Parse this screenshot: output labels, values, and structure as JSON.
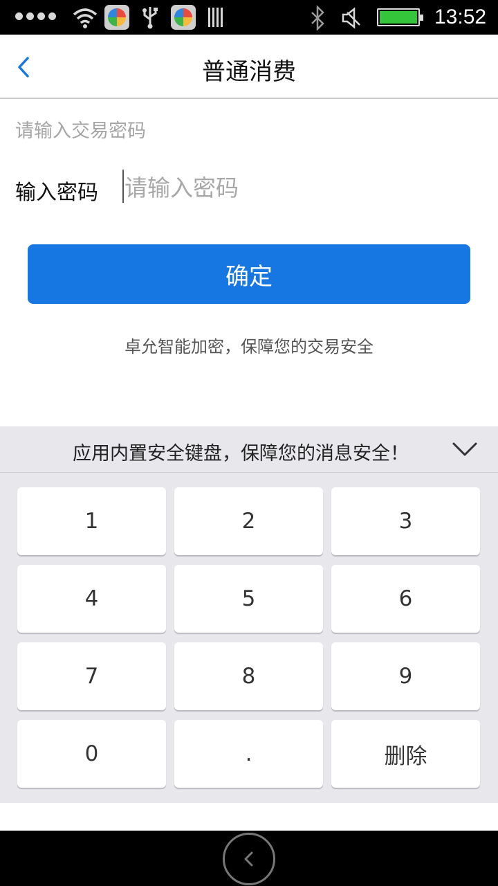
{
  "status_bar": {
    "time": "13:52",
    "icons": [
      "signal-dots-icon",
      "wifi-icon",
      "app-icon",
      "usb-icon",
      "app-icon",
      "barcode-icon",
      "bluetooth-icon",
      "mute-icon",
      "battery-icon"
    ],
    "battery_level": 1.0
  },
  "header": {
    "title": "普通消费",
    "back_icon": "chevron-left-icon"
  },
  "form": {
    "hint": "请输入交易密码",
    "password_label": "输入密码",
    "password_placeholder": "请输入密码",
    "password_value": ""
  },
  "confirm_button": {
    "label": "确定"
  },
  "security_note": "卓允智能加密，保障您的交易安全",
  "keyboard": {
    "title": "应用内置安全键盘，保障您的消息安全！",
    "collapse_icon": "chevron-down-icon",
    "keys": [
      "1",
      "2",
      "3",
      "4",
      "5",
      "6",
      "7",
      "8",
      "9",
      "0",
      ".",
      "删除"
    ]
  },
  "colors": {
    "accent": "#1677e3",
    "keyboard_bg": "#e7e7ec",
    "battery": "#35c53a"
  }
}
